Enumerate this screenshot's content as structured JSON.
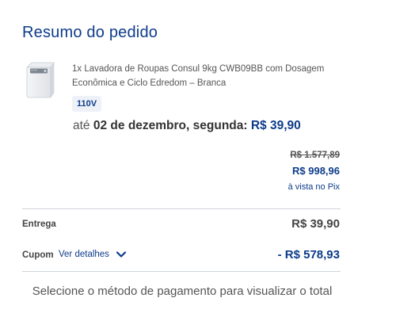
{
  "summary": {
    "title": "Resumo do pedido"
  },
  "product": {
    "name": "1x Lavadora de Roupas Consul 9kg CWB09BB com Dosagem Econômica e Ciclo Edredom – Branca",
    "variant": "110V",
    "image_icon": "washing-machine-icon",
    "delivery_prefix": "até",
    "delivery_date": "02 de dezembro, segunda:",
    "delivery_price": "R$ 39,90",
    "old_price": "R$ 1.577,89",
    "pix_price": "R$ 998,96",
    "pix_note": "à vista no Pix"
  },
  "totals": {
    "shipping_label": "Entrega",
    "shipping_value": "R$ 39,90",
    "coupon_label": "Cupom",
    "coupon_details_link": "Ver detalhes",
    "coupon_value": "- R$ 578,93"
  },
  "footer": {
    "note": "Selecione o método de pagamento para visualizar o total"
  },
  "colors": {
    "brand_blue": "#0d3c8a",
    "text_gray": "#555555",
    "divider": "#cfd3da",
    "variant_bg": "#eef1f8"
  }
}
